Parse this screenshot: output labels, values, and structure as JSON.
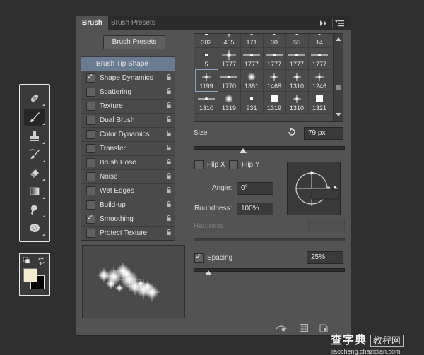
{
  "tabs": [
    {
      "label": "Brush",
      "active": true
    },
    {
      "label": "Brush Presets",
      "active": false
    }
  ],
  "panel_menu_icons": [
    "double-arrow-icon",
    "panel-menu-icon"
  ],
  "presets_button": "Brush Presets",
  "options": [
    {
      "label": "Brush Tip Shape",
      "header": true,
      "checked": false,
      "lock": false
    },
    {
      "label": "Shape Dynamics",
      "checked": true,
      "lock": true
    },
    {
      "label": "Scattering",
      "checked": false,
      "lock": true
    },
    {
      "label": "Texture",
      "checked": false,
      "lock": true
    },
    {
      "label": "Dual Brush",
      "checked": false,
      "lock": true
    },
    {
      "label": "Color Dynamics",
      "checked": false,
      "lock": true
    },
    {
      "label": "Transfer",
      "checked": false,
      "lock": true
    },
    {
      "label": "Brush Pose",
      "checked": false,
      "lock": true
    },
    {
      "label": "Noise",
      "checked": false,
      "lock": true
    },
    {
      "label": "Wet Edges",
      "checked": false,
      "lock": true
    },
    {
      "label": "Build-up",
      "checked": false,
      "lock": true
    },
    {
      "label": "Smoothing",
      "checked": true,
      "lock": true
    },
    {
      "label": "Protect Texture",
      "checked": false,
      "lock": true
    }
  ],
  "tips": [
    [
      {
        "n": "302",
        "g": "dot"
      },
      {
        "n": "455",
        "g": "star"
      },
      {
        "n": "171",
        "g": "line"
      },
      {
        "n": "30",
        "g": "line"
      },
      {
        "n": "55",
        "g": "line"
      },
      {
        "n": "14",
        "g": "line"
      }
    ],
    [
      {
        "n": "5",
        "g": "dot"
      },
      {
        "n": "1777",
        "g": "flare"
      },
      {
        "n": "1777",
        "g": "line"
      },
      {
        "n": "1777",
        "g": "line"
      },
      {
        "n": "1777",
        "g": "line"
      },
      {
        "n": "1777",
        "g": "line"
      }
    ],
    [
      {
        "n": "1199",
        "g": "star",
        "sel": true
      },
      {
        "n": "1770",
        "g": "line"
      },
      {
        "n": "1381",
        "g": "glow"
      },
      {
        "n": "1468",
        "g": "star"
      },
      {
        "n": "1310",
        "g": "star"
      },
      {
        "n": "1246",
        "g": "star"
      }
    ],
    [
      {
        "n": "1310",
        "g": "line"
      },
      {
        "n": "1319",
        "g": "glow"
      },
      {
        "n": "931",
        "g": "dot"
      },
      {
        "n": "1319",
        "g": "square"
      },
      {
        "n": "1310",
        "g": "star"
      },
      {
        "n": "1321",
        "g": "square"
      }
    ]
  ],
  "size": {
    "label": "Size",
    "value": "79 px",
    "slider": 0.33
  },
  "flip_x": {
    "label": "Flip X",
    "checked": false
  },
  "flip_y": {
    "label": "Flip Y",
    "checked": false
  },
  "angle": {
    "label": "Angle:",
    "value": "0°"
  },
  "roundness": {
    "label": "Roundness:",
    "value": "100%"
  },
  "hardness": {
    "label": "Hardness",
    "value": ""
  },
  "spacing": {
    "label": "Spacing",
    "checked": true,
    "value": "25%",
    "slider": 0.1
  },
  "tools": [
    "bandage-icon",
    "brush-icon",
    "stamp-icon",
    "history-brush-icon",
    "eraser-icon",
    "gradient-icon",
    "smudge-icon",
    "sponge-icon"
  ],
  "active_tool": 1,
  "colors": {
    "foreground": "#f3ead2",
    "background": "#000000"
  },
  "bottom_icons": [
    "toggle-live-tip-icon",
    "grid-icon",
    "new-preset-icon"
  ],
  "watermark": {
    "brand": "查字典",
    "brand2": "教程网",
    "url": "jiaocheng.chazidian.com"
  }
}
